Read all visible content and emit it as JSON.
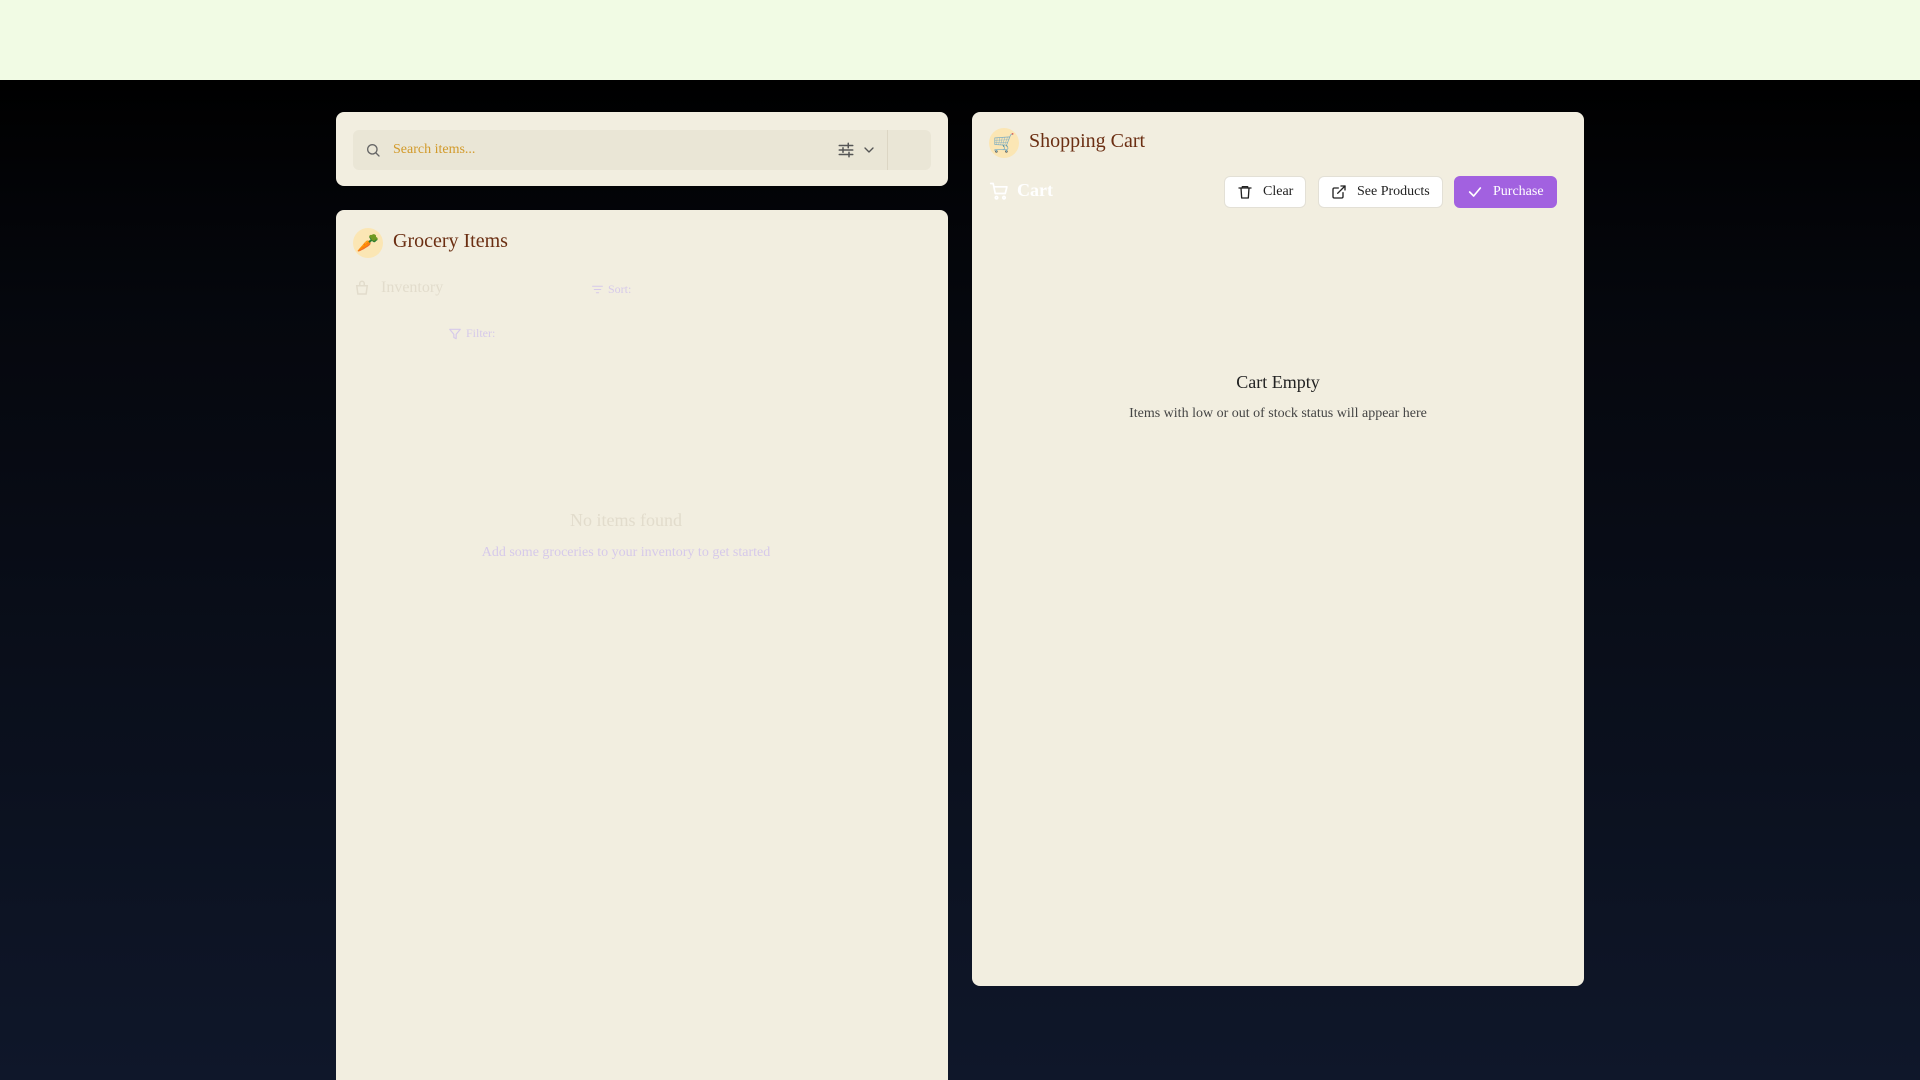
{
  "search": {
    "placeholder": "Search items...",
    "icons": [
      "search-icon",
      "sliders-icon",
      "chevron-down-icon"
    ]
  },
  "grocery": {
    "emoji": "🥕",
    "title": "Grocery Items",
    "category_label": "Inventory",
    "sort_label": "Sort:",
    "filter_label": "Filter:",
    "empty_title": "No items found",
    "empty_desc": "Add some groceries to your inventory to get started"
  },
  "cart": {
    "emoji": "🛒",
    "title": "Shopping Cart",
    "subtitle": "Cart",
    "buttons": {
      "clear": "Clear",
      "see_products": "See Products",
      "purchase": "Purchase"
    },
    "empty_title": "Cart Empty",
    "empty_desc": "Items with low or out of stock status will appear here"
  },
  "colors": {
    "topbar": "#f1fbe4",
    "panel": "#f2eee0",
    "title": "#6b2e12",
    "accent_purple": "#a261e0",
    "placeholder": "#d29a2a"
  }
}
